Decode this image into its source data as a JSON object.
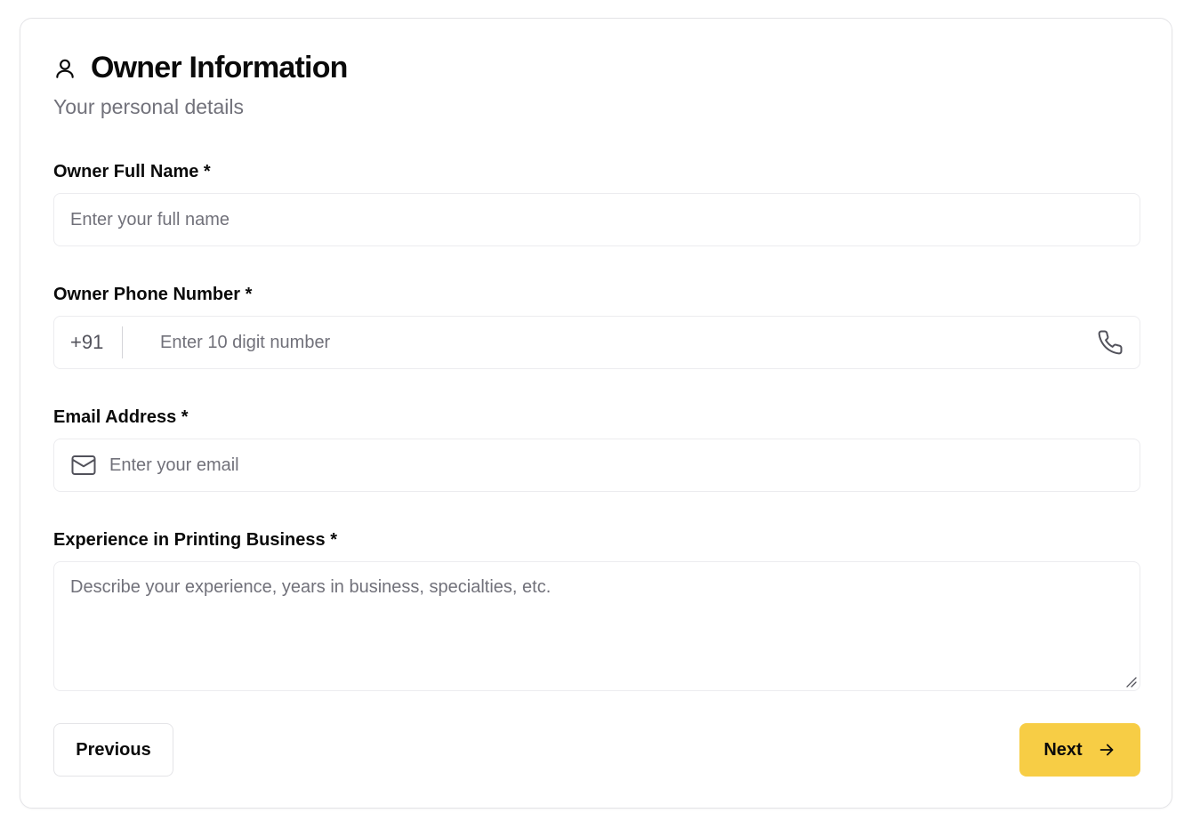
{
  "section": {
    "title": "Owner Information",
    "subtitle": "Your personal details",
    "icon": "user-icon"
  },
  "fields": {
    "full_name": {
      "label": "Owner Full Name *",
      "placeholder": "Enter your full name",
      "value": ""
    },
    "phone": {
      "label": "Owner Phone Number *",
      "prefix": "+91",
      "placeholder": "Enter 10 digit number",
      "value": "",
      "icon": "phone-icon"
    },
    "email": {
      "label": "Email Address *",
      "placeholder": "Enter your email",
      "value": "",
      "icon": "mail-icon"
    },
    "experience": {
      "label": "Experience in Printing Business *",
      "placeholder": "Describe your experience, years in business, specialties, etc.",
      "value": ""
    }
  },
  "buttons": {
    "previous_label": "Previous",
    "next_label": "Next",
    "next_icon": "arrow-right-icon"
  },
  "colors": {
    "accent": "#f7cd45",
    "border": "#ececef",
    "muted_text": "#71717a"
  }
}
